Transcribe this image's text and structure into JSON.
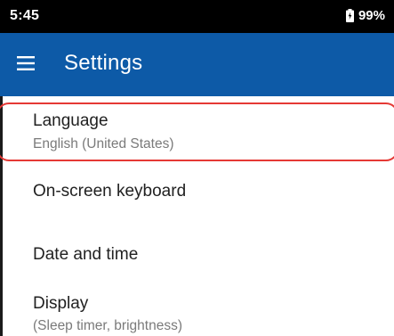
{
  "status_bar": {
    "time": "5:45",
    "battery_percent": "99%",
    "battery_icon": "battery-charging-icon"
  },
  "app_bar": {
    "menu_icon": "hamburger-menu-icon",
    "title": "Settings",
    "color": "#0d5aa7"
  },
  "settings_list": [
    {
      "title": "Language",
      "subtitle": "English (United States)"
    },
    {
      "title": "On-screen keyboard"
    },
    {
      "title": "Date and time"
    },
    {
      "title": "Display",
      "subtitle": "(Sleep timer, brightness)"
    }
  ],
  "highlight": {
    "target": "Language",
    "color": "#e53935"
  }
}
